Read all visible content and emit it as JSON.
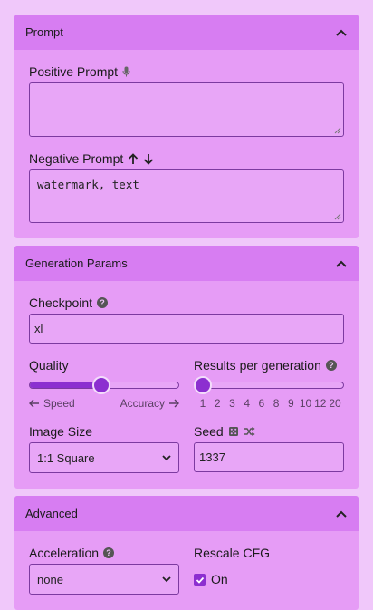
{
  "sections": {
    "prompt": {
      "title": "Prompt",
      "positive_label": "Positive Prompt",
      "positive_value": "",
      "negative_label": "Negative Prompt",
      "negative_value": "watermark, text"
    },
    "generation": {
      "title": "Generation Params",
      "checkpoint_label": "Checkpoint",
      "checkpoint_value": "xl",
      "quality_label": "Quality",
      "quality_level": 0.48,
      "quality_hint_left": "Speed",
      "quality_hint_right": "Accuracy",
      "results_label": "Results per generation",
      "results_value": 1,
      "results_ticks": [
        "1",
        "2",
        "3",
        "4",
        "6",
        "8",
        "9",
        "10",
        "12",
        "20"
      ],
      "image_size_label": "Image Size",
      "image_size_value": "1:1 Square",
      "seed_label": "Seed",
      "seed_value": "1337"
    },
    "advanced": {
      "title": "Advanced",
      "acceleration_label": "Acceleration",
      "acceleration_value": "none",
      "rescale_label": "Rescale CFG",
      "rescale_checkbox_label": "On",
      "rescale_checked": true
    }
  },
  "icons": [
    "chevron-up-icon",
    "microphone-icon",
    "arrow-up-icon",
    "arrow-down-icon",
    "help-icon",
    "arrow-left-icon",
    "arrow-right-icon",
    "dice-icon",
    "shuffle-icon",
    "chevron-down-icon",
    "checkmark-icon"
  ],
  "colors": {
    "page_bg": "#f0c8fa",
    "section_bg": "#e69cf6",
    "header_bg": "#d77df2",
    "accent": "#8c2fd0"
  }
}
